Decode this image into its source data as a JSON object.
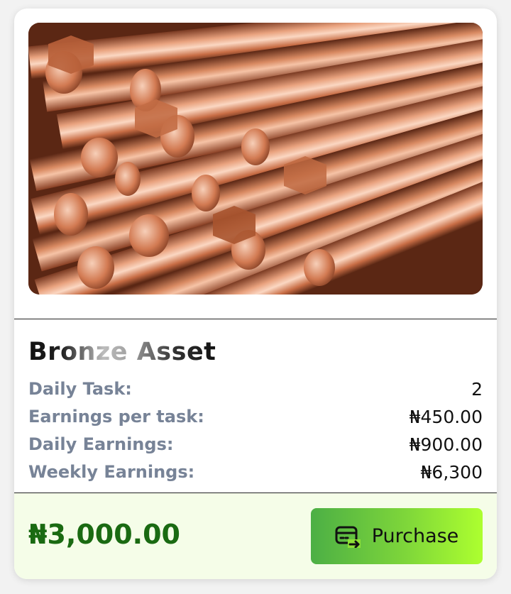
{
  "card": {
    "image_alt": "Copper / bronze rods and bars",
    "title": "Bronze Asset",
    "details": [
      {
        "label": "Daily Task:",
        "value": "2"
      },
      {
        "label": "Earnings per task:",
        "value": "₦450.00"
      },
      {
        "label": "Daily Earnings:",
        "value": "₦900.00"
      },
      {
        "label": "Weekly Earnings:",
        "value": "₦6,300"
      }
    ],
    "price": "₦3,000.00",
    "purchase_label": "Purchase",
    "purchase_icon": "card-transfer-icon"
  },
  "colors": {
    "label": "#778397",
    "price": "#1a6a12",
    "footer_bg": "#f5fde8",
    "button_from": "#4caf45",
    "button_to": "#adff2f"
  }
}
